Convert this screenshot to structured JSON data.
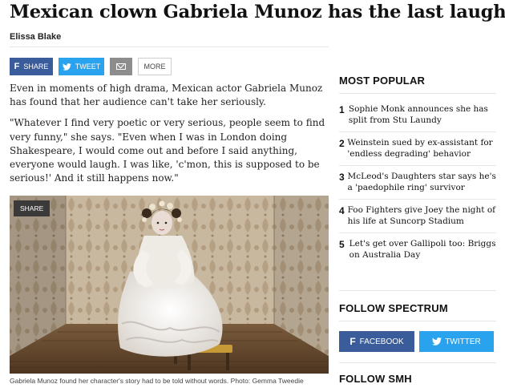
{
  "article": {
    "headline": "Mexican clown Gabriela Munoz has the last laugh",
    "byline": "Elissa Blake",
    "share": {
      "facebook": "SHARE",
      "twitter": "TWEET",
      "more": "MORE"
    },
    "paragraphs": [
      "Even in moments of high drama, Mexican actor Gabriela Munoz has found that her audience can't take her seriously.",
      "\"Whatever I find very poetic or very serious, people seem to find very funny,\" she says. \"Even when I was in London doing Shakespeare, I would come out and before I said anything, everyone would laugh. I was like, 'c'mon, this is supposed to be serious!' And it still happens now.\""
    ],
    "photo_share": "SHARE",
    "caption": "Gabriela Munoz found her character's story had to be told without words. Photo: Gemma Tweedie"
  },
  "sidebar": {
    "most_popular_title": "MOST POPULAR",
    "most_popular": [
      {
        "num": "1",
        "text": "Sophie Monk announces she has split from Stu Laundy"
      },
      {
        "num": "2",
        "text": "Weinstein sued by ex-assistant for 'endless degrading' behavior"
      },
      {
        "num": "3",
        "text": "McLeod's Daughters star says he's a 'paedophile ring' survivor"
      },
      {
        "num": "4",
        "text": "Foo Fighters give Joey the night of his life at Suncorp Stadium"
      },
      {
        "num": "5",
        "text": "Let's get over Gallipoli too: Briggs on Australia Day"
      }
    ],
    "follow_spectrum_title": "FOLLOW SPECTRUM",
    "follow_facebook": "FACEBOOK",
    "follow_twitter": "TWITTER",
    "follow_smh_title": "FOLLOW SMH"
  },
  "colors": {
    "facebook": "#3b5c9a",
    "twitter": "#2aa3ef",
    "mail": "#8d8d8d"
  },
  "icons": {
    "facebook": "facebook-icon",
    "twitter": "twitter-bird-icon",
    "email": "envelope-icon"
  }
}
